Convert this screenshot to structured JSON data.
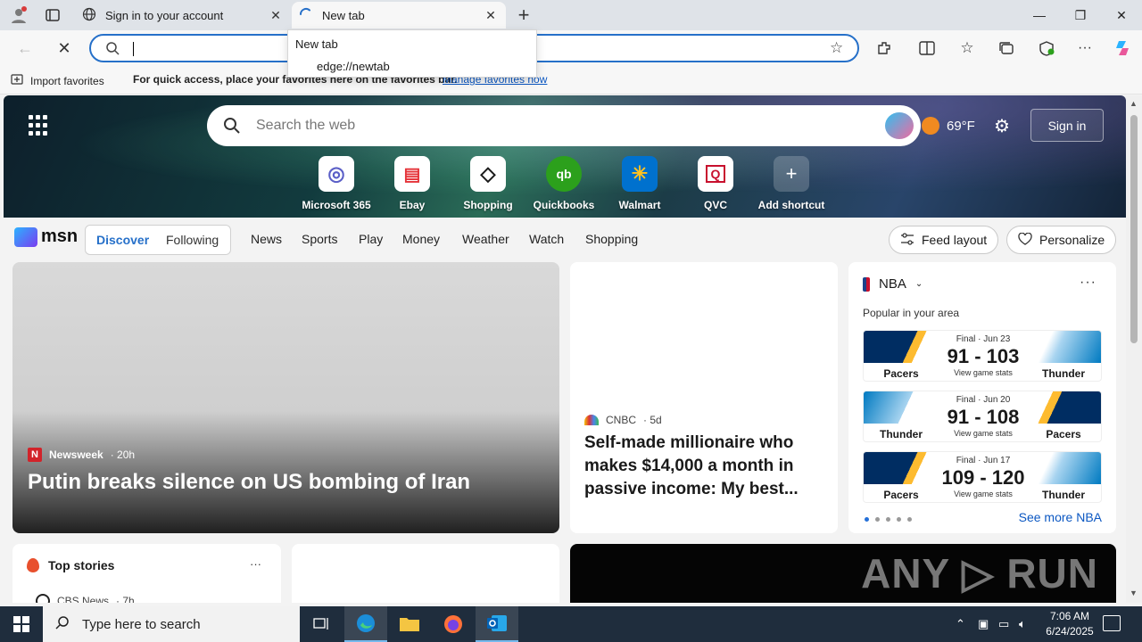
{
  "browser": {
    "tabs": [
      {
        "title": "Sign in to your account",
        "active": false
      },
      {
        "title": "New tab",
        "active": true
      }
    ],
    "new_tab_symbol": "+",
    "window_controls": {
      "minimize": "—",
      "restore": "❐",
      "close": "✕"
    },
    "address": {
      "value": "",
      "dropdown": [
        "New tab",
        "edge://newtab"
      ]
    },
    "favorites_bar": {
      "import_label": "Import favorites",
      "hint": "For quick access, place your favorites here on the favorites bar.",
      "link": "Manage favorites now"
    }
  },
  "newtab": {
    "search_placeholder": "Search the web",
    "weather": {
      "temp": "69°F"
    },
    "signin_label": "Sign in",
    "shortcuts": [
      {
        "label": "Microsoft 365",
        "glyph": "◎",
        "color": "#5b5fc7"
      },
      {
        "label": "Ebay",
        "glyph": "▤",
        "color": "#1a1a1a"
      },
      {
        "label": "Shopping",
        "glyph": "◇",
        "color": "#1a1a1a"
      },
      {
        "label": "Quickbooks",
        "glyph": "qb",
        "color": "#2ca01c"
      },
      {
        "label": "Walmart",
        "glyph": "✳",
        "color": "#0071ce"
      },
      {
        "label": "QVC",
        "glyph": "Q",
        "color": "#c8102e"
      },
      {
        "label": "Add shortcut",
        "glyph": "+",
        "color": "#ffffff"
      }
    ],
    "msn_nav": {
      "logo": "msn",
      "segments": [
        "Discover",
        "Following"
      ],
      "items": [
        "News",
        "Sports",
        "Play",
        "Money",
        "Weather",
        "Watch",
        "Shopping"
      ],
      "feed_layout": "Feed layout",
      "personalize": "Personalize"
    },
    "hero_card": {
      "source": "Newsweek",
      "time": "· 20h",
      "headline": "Putin breaks silence on US bombing of Iran"
    },
    "mid_card": {
      "source": "CNBC",
      "time": "· 5d",
      "headline": "Self-made millionaire who makes $14,000 a month in passive income: My best..."
    },
    "nba": {
      "title": "NBA",
      "subtitle": "Popular in your area",
      "games": [
        {
          "status": "Final · Jun 23",
          "score": "91 - 103",
          "stats": "View game stats",
          "left": "Pacers",
          "right": "Thunder"
        },
        {
          "status": "Final · Jun 20",
          "score": "91 - 108",
          "stats": "View game stats",
          "left": "Thunder",
          "right": "Pacers"
        },
        {
          "status": "Final · Jun 17",
          "score": "109 - 120",
          "stats": "View game stats",
          "left": "Pacers",
          "right": "Thunder"
        }
      ],
      "see_more": "See more NBA"
    },
    "top_stories": {
      "title": "Top stories",
      "source": "CBS News",
      "time": "· 7h"
    },
    "video_watermark": "ANY ▷ RUN"
  },
  "taskbar": {
    "search_placeholder": "Type here to search",
    "time": "7:06 AM",
    "date": "6/24/2025"
  }
}
